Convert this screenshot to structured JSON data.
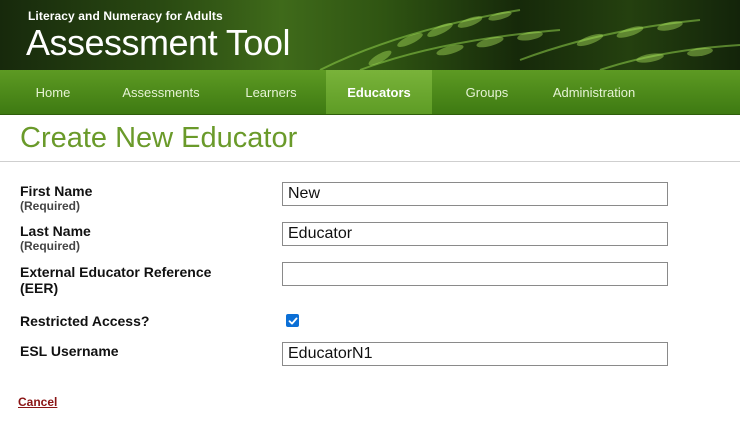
{
  "banner": {
    "subtitle": "Literacy and Numeracy for Adults",
    "title": "Assessment Tool"
  },
  "nav": {
    "items": [
      {
        "label": "Home",
        "active": false
      },
      {
        "label": "Assessments",
        "active": false
      },
      {
        "label": "Learners",
        "active": false
      },
      {
        "label": "Educators",
        "active": true
      },
      {
        "label": "Groups",
        "active": false
      },
      {
        "label": "Administration",
        "active": false
      }
    ]
  },
  "page": {
    "title": "Create New Educator"
  },
  "form": {
    "first_name": {
      "label": "First Name",
      "note": "(Required)",
      "value": "New"
    },
    "last_name": {
      "label": "Last Name",
      "note": "(Required)",
      "value": "Educator"
    },
    "eer": {
      "label_line1": "External Educator Reference",
      "label_line2": "(EER)",
      "value": ""
    },
    "restricted": {
      "label": "Restricted Access?",
      "checked": true
    },
    "esl_username": {
      "label": "ESL Username",
      "value": "EducatorN1"
    }
  },
  "actions": {
    "cancel_label": "Cancel"
  },
  "colors": {
    "nav_green": "#4a8a1a",
    "title_green": "#6a9a2a",
    "cancel_red": "#8a1414",
    "checkbox_blue": "#0b6fd6"
  }
}
